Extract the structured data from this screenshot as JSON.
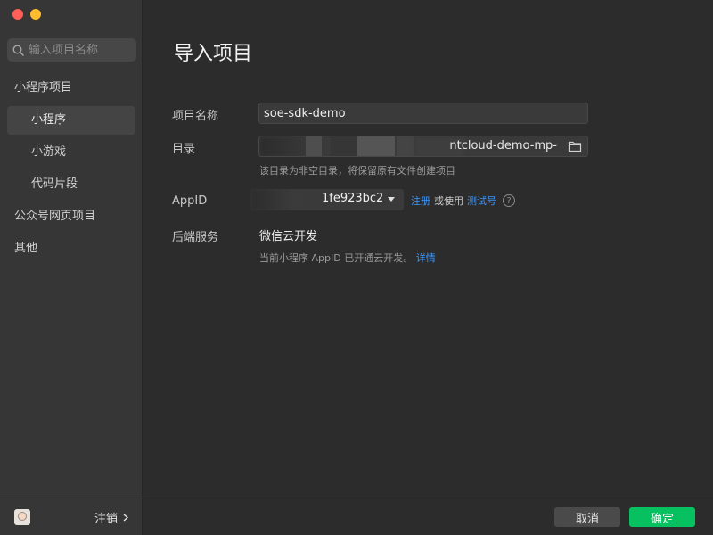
{
  "sidebar": {
    "search_placeholder": "输入项目名称",
    "items": [
      {
        "label": "小程序项目"
      },
      {
        "label": "小程序"
      },
      {
        "label": "小游戏"
      },
      {
        "label": "代码片段"
      },
      {
        "label": "公众号网页项目"
      },
      {
        "label": "其他"
      }
    ],
    "logout_label": "注销"
  },
  "main": {
    "title": "导入项目",
    "project_name": {
      "label": "项目名称",
      "value": "soe-sdk-demo"
    },
    "directory": {
      "label": "目录",
      "value_visible": "ntcloud-demo-mp-",
      "hint": "该目录为非空目录，将保留原有文件创建项目"
    },
    "appid": {
      "label": "AppID",
      "value_visible": "1fe923bc2",
      "register": "注册",
      "or_use": "或使用",
      "test_id": "测试号"
    },
    "backend": {
      "label": "后端服务",
      "value": "微信云开发",
      "hint": "当前小程序 AppID 已开通云开发。",
      "detail_link": "详情"
    }
  },
  "footer": {
    "cancel": "取消",
    "confirm": "确定"
  },
  "colors": {
    "accent_green": "#07c160",
    "link_blue": "#3e95f5",
    "close_red": "#ff5f57",
    "minimize_yellow": "#febc2e"
  }
}
